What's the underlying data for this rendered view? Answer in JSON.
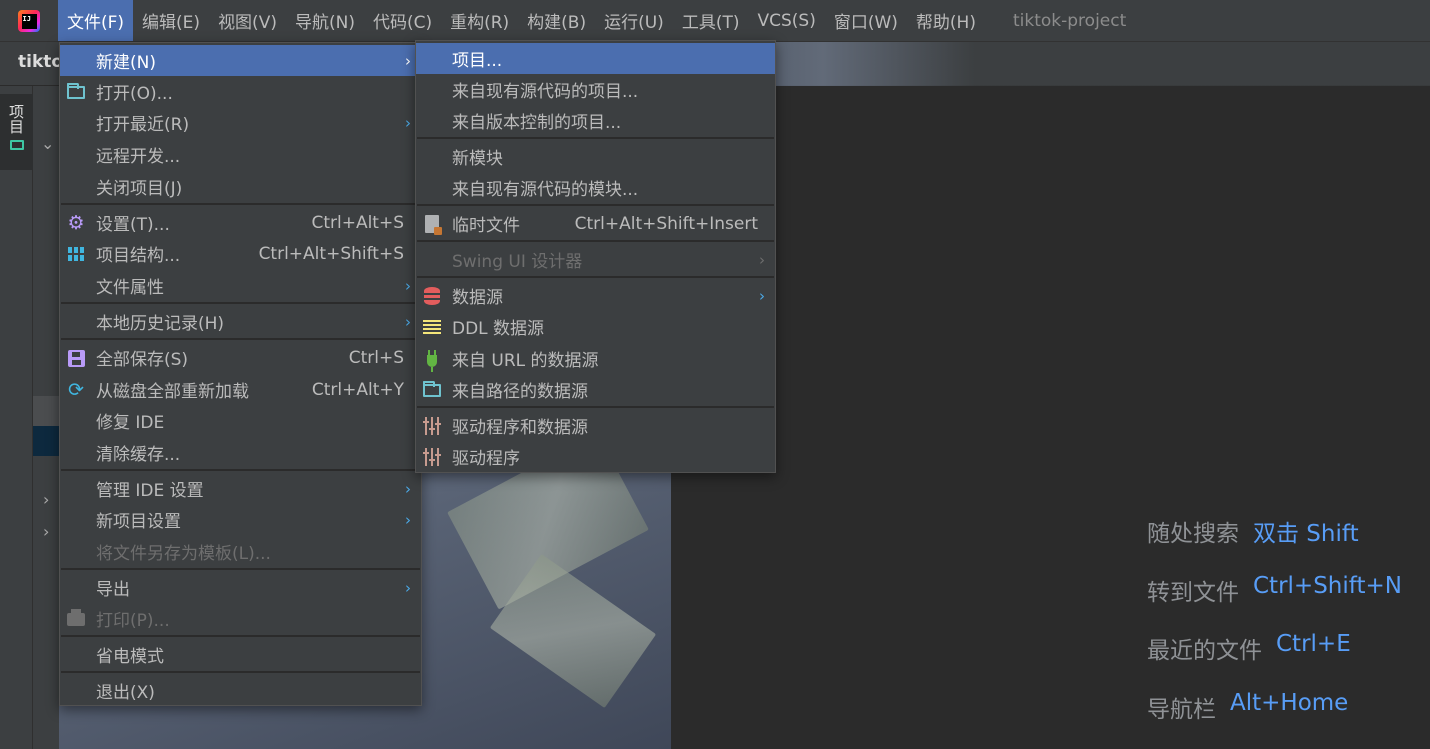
{
  "window": {
    "title": "tiktok-project"
  },
  "menubar": {
    "items": [
      "文件(F)",
      "编辑(E)",
      "视图(V)",
      "导航(N)",
      "代码(C)",
      "重构(R)",
      "构建(B)",
      "运行(U)",
      "工具(T)",
      "VCS(S)",
      "窗口(W)",
      "帮助(H)"
    ],
    "active_index": 0
  },
  "toolbar": {
    "project_name": "tikto"
  },
  "left_strip": {
    "project_tab_label": "项目"
  },
  "file_menu": {
    "items": [
      {
        "label": "新建(N)",
        "submenu": true,
        "selected": true
      },
      {
        "label": "打开(O)...",
        "icon": "folder-icon"
      },
      {
        "label": "打开最近(R)",
        "submenu": true
      },
      {
        "label": "远程开发..."
      },
      {
        "label": "关闭项目(J)"
      },
      {
        "label": "设置(T)...",
        "shortcut": "Ctrl+Alt+S",
        "icon": "gear-icon"
      },
      {
        "label": "项目结构...",
        "shortcut": "Ctrl+Alt+Shift+S",
        "icon": "project-structure-icon"
      },
      {
        "label": "文件属性",
        "submenu": true
      },
      {
        "label": "本地历史记录(H)",
        "submenu": true
      },
      {
        "label": "全部保存(S)",
        "shortcut": "Ctrl+S",
        "icon": "save-icon"
      },
      {
        "label": "从磁盘全部重新加载",
        "shortcut": "Ctrl+Alt+Y",
        "icon": "reload-icon"
      },
      {
        "label": "修复 IDE"
      },
      {
        "label": "清除缓存..."
      },
      {
        "label": "管理 IDE 设置",
        "submenu": true
      },
      {
        "label": "新项目设置",
        "submenu": true
      },
      {
        "label": "将文件另存为模板(L)...",
        "disabled": true
      },
      {
        "label": "导出",
        "submenu": true
      },
      {
        "label": "打印(P)...",
        "disabled": true,
        "icon": "print-icon"
      },
      {
        "label": "省电模式"
      },
      {
        "label": "退出(X)"
      }
    ]
  },
  "new_menu": {
    "items": [
      {
        "label": "项目...",
        "selected": true
      },
      {
        "label": "来自现有源代码的项目..."
      },
      {
        "label": "来自版本控制的项目..."
      },
      {
        "label": "新模块"
      },
      {
        "label": "来自现有源代码的模块..."
      },
      {
        "label": "临时文件",
        "shortcut": "Ctrl+Alt+Shift+Insert",
        "icon": "scratch-file-icon"
      },
      {
        "label": "Swing UI 设计器",
        "submenu": true,
        "disabled": true
      },
      {
        "label": "数据源",
        "submenu": true,
        "icon": "database-icon"
      },
      {
        "label": "DDL 数据源",
        "icon": "ddl-list-icon"
      },
      {
        "label": "来自 URL 的数据源",
        "icon": "plug-icon"
      },
      {
        "label": "来自路径的数据源",
        "icon": "folder-icon"
      },
      {
        "label": "驱动程序和数据源",
        "icon": "driver-icon"
      },
      {
        "label": "驱动程序",
        "icon": "driver-icon"
      }
    ]
  },
  "editor_hints": [
    {
      "label": "随处搜索",
      "key": "双击 Shift"
    },
    {
      "label": "转到文件",
      "key": "Ctrl+Shift+N"
    },
    {
      "label": "最近的文件",
      "key": "Ctrl+E"
    },
    {
      "label": "导航栏",
      "key": "Alt+Home"
    }
  ],
  "colors": {
    "selection": "#4b6eaf",
    "hint_key": "#589df6",
    "menu_bg": "#3c3f41"
  }
}
